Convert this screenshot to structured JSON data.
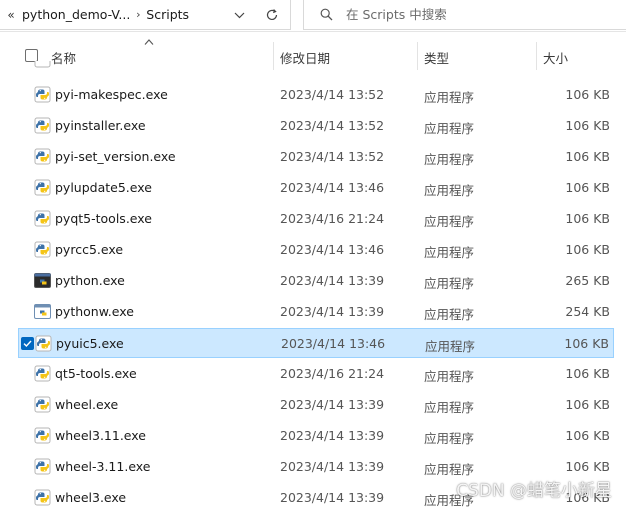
{
  "address": {
    "more_glyph": "«",
    "crumbs": [
      "python_demo-V...",
      "Scripts"
    ],
    "separator": "›"
  },
  "search": {
    "placeholder": "在 Scripts 中搜索"
  },
  "columns": {
    "name": "名称",
    "date": "修改日期",
    "type": "类型",
    "size": "大小"
  },
  "files": [
    {
      "name": "pyi-makespec.exe",
      "date": "2023/4/14 13:52",
      "type": "应用程序",
      "size": "106 KB",
      "icon": "python-launcher-icon"
    },
    {
      "name": "pyinstaller.exe",
      "date": "2023/4/14 13:52",
      "type": "应用程序",
      "size": "106 KB",
      "icon": "python-launcher-icon"
    },
    {
      "name": "pyi-set_version.exe",
      "date": "2023/4/14 13:52",
      "type": "应用程序",
      "size": "106 KB",
      "icon": "python-launcher-icon"
    },
    {
      "name": "pylupdate5.exe",
      "date": "2023/4/14 13:46",
      "type": "应用程序",
      "size": "106 KB",
      "icon": "python-launcher-icon"
    },
    {
      "name": "pyqt5-tools.exe",
      "date": "2023/4/16 21:24",
      "type": "应用程序",
      "size": "106 KB",
      "icon": "python-launcher-icon"
    },
    {
      "name": "pyrcc5.exe",
      "date": "2023/4/14 13:46",
      "type": "应用程序",
      "size": "106 KB",
      "icon": "python-launcher-icon"
    },
    {
      "name": "python.exe",
      "date": "2023/4/14 13:39",
      "type": "应用程序",
      "size": "265 KB",
      "icon": "python-console-icon"
    },
    {
      "name": "pythonw.exe",
      "date": "2023/4/14 13:39",
      "type": "应用程序",
      "size": "254 KB",
      "icon": "python-window-icon"
    },
    {
      "name": "pyuic5.exe",
      "date": "2023/4/14 13:46",
      "type": "应用程序",
      "size": "106 KB",
      "icon": "python-launcher-icon",
      "selected": true
    },
    {
      "name": "qt5-tools.exe",
      "date": "2023/4/16 21:24",
      "type": "应用程序",
      "size": "106 KB",
      "icon": "python-launcher-icon"
    },
    {
      "name": "wheel.exe",
      "date": "2023/4/14 13:39",
      "type": "应用程序",
      "size": "106 KB",
      "icon": "python-launcher-icon"
    },
    {
      "name": "wheel3.11.exe",
      "date": "2023/4/14 13:39",
      "type": "应用程序",
      "size": "106 KB",
      "icon": "python-launcher-icon"
    },
    {
      "name": "wheel-3.11.exe",
      "date": "2023/4/14 13:39",
      "type": "应用程序",
      "size": "106 KB",
      "icon": "python-launcher-icon"
    },
    {
      "name": "wheel3.exe",
      "date": "2023/4/14 13:39",
      "type": "应用程序",
      "size": "106 KB",
      "icon": "python-launcher-icon"
    }
  ],
  "watermark": "CSDN @蜡笔小新星",
  "colors": {
    "selection_bg": "#cce8ff",
    "selection_border": "#99d1ff",
    "check_blue": "#0067c0",
    "python_blue": "#3d72a8",
    "python_yellow": "#f5c518"
  }
}
